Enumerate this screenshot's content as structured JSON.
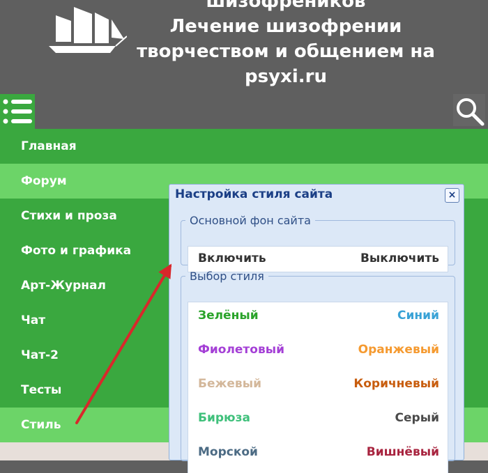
{
  "header": {
    "title_lines": [
      "шизофреников",
      "Лечение шизофрении",
      "творчеством и общением на",
      "psyxi.ru"
    ],
    "logo": "sailing-ship-logo",
    "menu_icon": "menu-icon",
    "search_icon": "search-icon"
  },
  "nav": {
    "items": [
      "Главная",
      "Форум",
      "Стихи и проза",
      "Фото и графика",
      "Арт-Журнал",
      "Чат",
      "Чат-2",
      "Тесты",
      "Стиль"
    ]
  },
  "style_dialog": {
    "title": "Настройка стиля сайта",
    "close": "×",
    "background_section": {
      "title": "Основной фон сайта",
      "enable": "Включить",
      "disable": "Выключить"
    },
    "style_section": {
      "title": "Выбор стиля",
      "options": [
        {
          "label": "Зелёный",
          "color": "#2aa32a"
        },
        {
          "label": "Синий",
          "color": "#39a2d6"
        },
        {
          "label": "Фиолетовый",
          "color": "#a43fd6"
        },
        {
          "label": "Оранжевый",
          "color": "#f59a30"
        },
        {
          "label": "Бежевый",
          "color": "#d3b79a"
        },
        {
          "label": "Коричневый",
          "color": "#c85d0e"
        },
        {
          "label": "Бирюза",
          "color": "#3fc07b"
        },
        {
          "label": "Серый",
          "color": "#4a4a4a"
        },
        {
          "label": "Морской",
          "color": "#4c6b84"
        },
        {
          "label": "Вишнёвый",
          "color": "#a8243f"
        }
      ]
    }
  },
  "colors": {
    "header_bg": "#5f5f5f",
    "nav_green": "#3aa83f",
    "nav_highlight": "#6cd468",
    "dialog_bg": "#dce8f7",
    "annotation_arrow": "#d8282b"
  }
}
